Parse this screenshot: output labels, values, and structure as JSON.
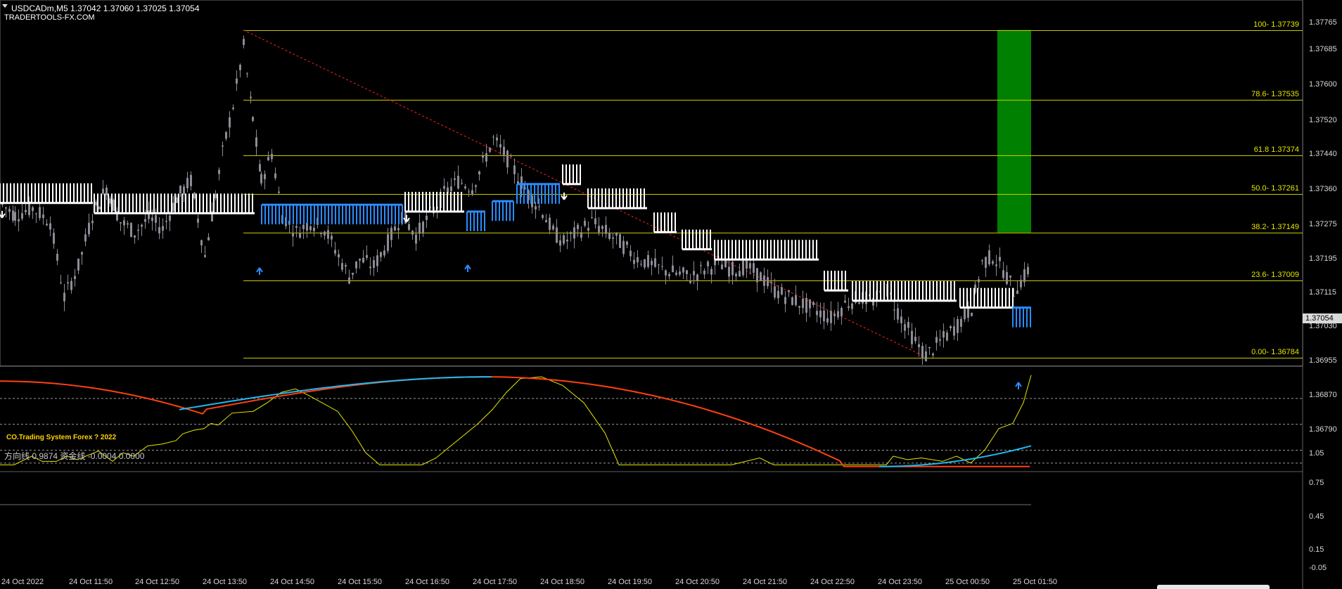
{
  "header": {
    "symbol_line": "USDCADm,M5  1.37042 1.37060 1.37025 1.37054",
    "site": "TRADERTOOLS-FX.COM"
  },
  "footer_note": "CO.Trading System Forex  ? 2022",
  "indicator": {
    "title": "方向线 0.9874  资金线 -0.0004 0.0000",
    "scale_labels": [
      "1.05",
      "0.75",
      "0.45",
      "0.15",
      "-0.05"
    ]
  },
  "price_axis": {
    "labels": [
      "1.37765",
      "1.37685",
      "1.37600",
      "1.37520",
      "1.37440",
      "1.37360",
      "1.37275",
      "1.37195",
      "1.37115",
      "1.37030",
      "1.36955",
      "1.36870",
      "1.36790"
    ],
    "current_price": "1.37054"
  },
  "fib_levels": [
    {
      "label": "100- 1.37739",
      "price": 1.37739
    },
    {
      "label": "78.6- 1.37535",
      "price": 1.37535
    },
    {
      "label": "61.8 1.37374",
      "price": 1.37374
    },
    {
      "label": "50.0- 1.37261",
      "price": 1.37261
    },
    {
      "label": "38.2- 1.37149",
      "price": 1.37149
    },
    {
      "label": "23.6- 1.37009",
      "price": 1.37009
    },
    {
      "label": "0.00- 1.36784",
      "price": 1.36784
    }
  ],
  "time_axis": {
    "labels": [
      "24 Oct 2022",
      "24 Oct 11:50",
      "24 Oct 12:50",
      "24 Oct 13:50",
      "24 Oct 14:50",
      "24 Oct 15:50",
      "24 Oct 16:50",
      "24 Oct 17:50",
      "24 Oct 18:50",
      "24 Oct 19:50",
      "24 Oct 20:50",
      "24 Oct 21:50",
      "24 Oct 22:50",
      "24 Oct 23:50",
      "25 Oct 00:50",
      "25 Oct 01:50"
    ]
  },
  "colors": {
    "background": "#000000",
    "fib_line": "#c8c800",
    "candle": "#8c8c96",
    "stop_white": "#ffffff",
    "stop_blue": "#2b8cff",
    "zone": "#008000",
    "trend": "#ff2020",
    "ind_yellow": "#e8e800",
    "ind_red": "#ff4010",
    "ind_cyan": "#20b8f0"
  }
}
